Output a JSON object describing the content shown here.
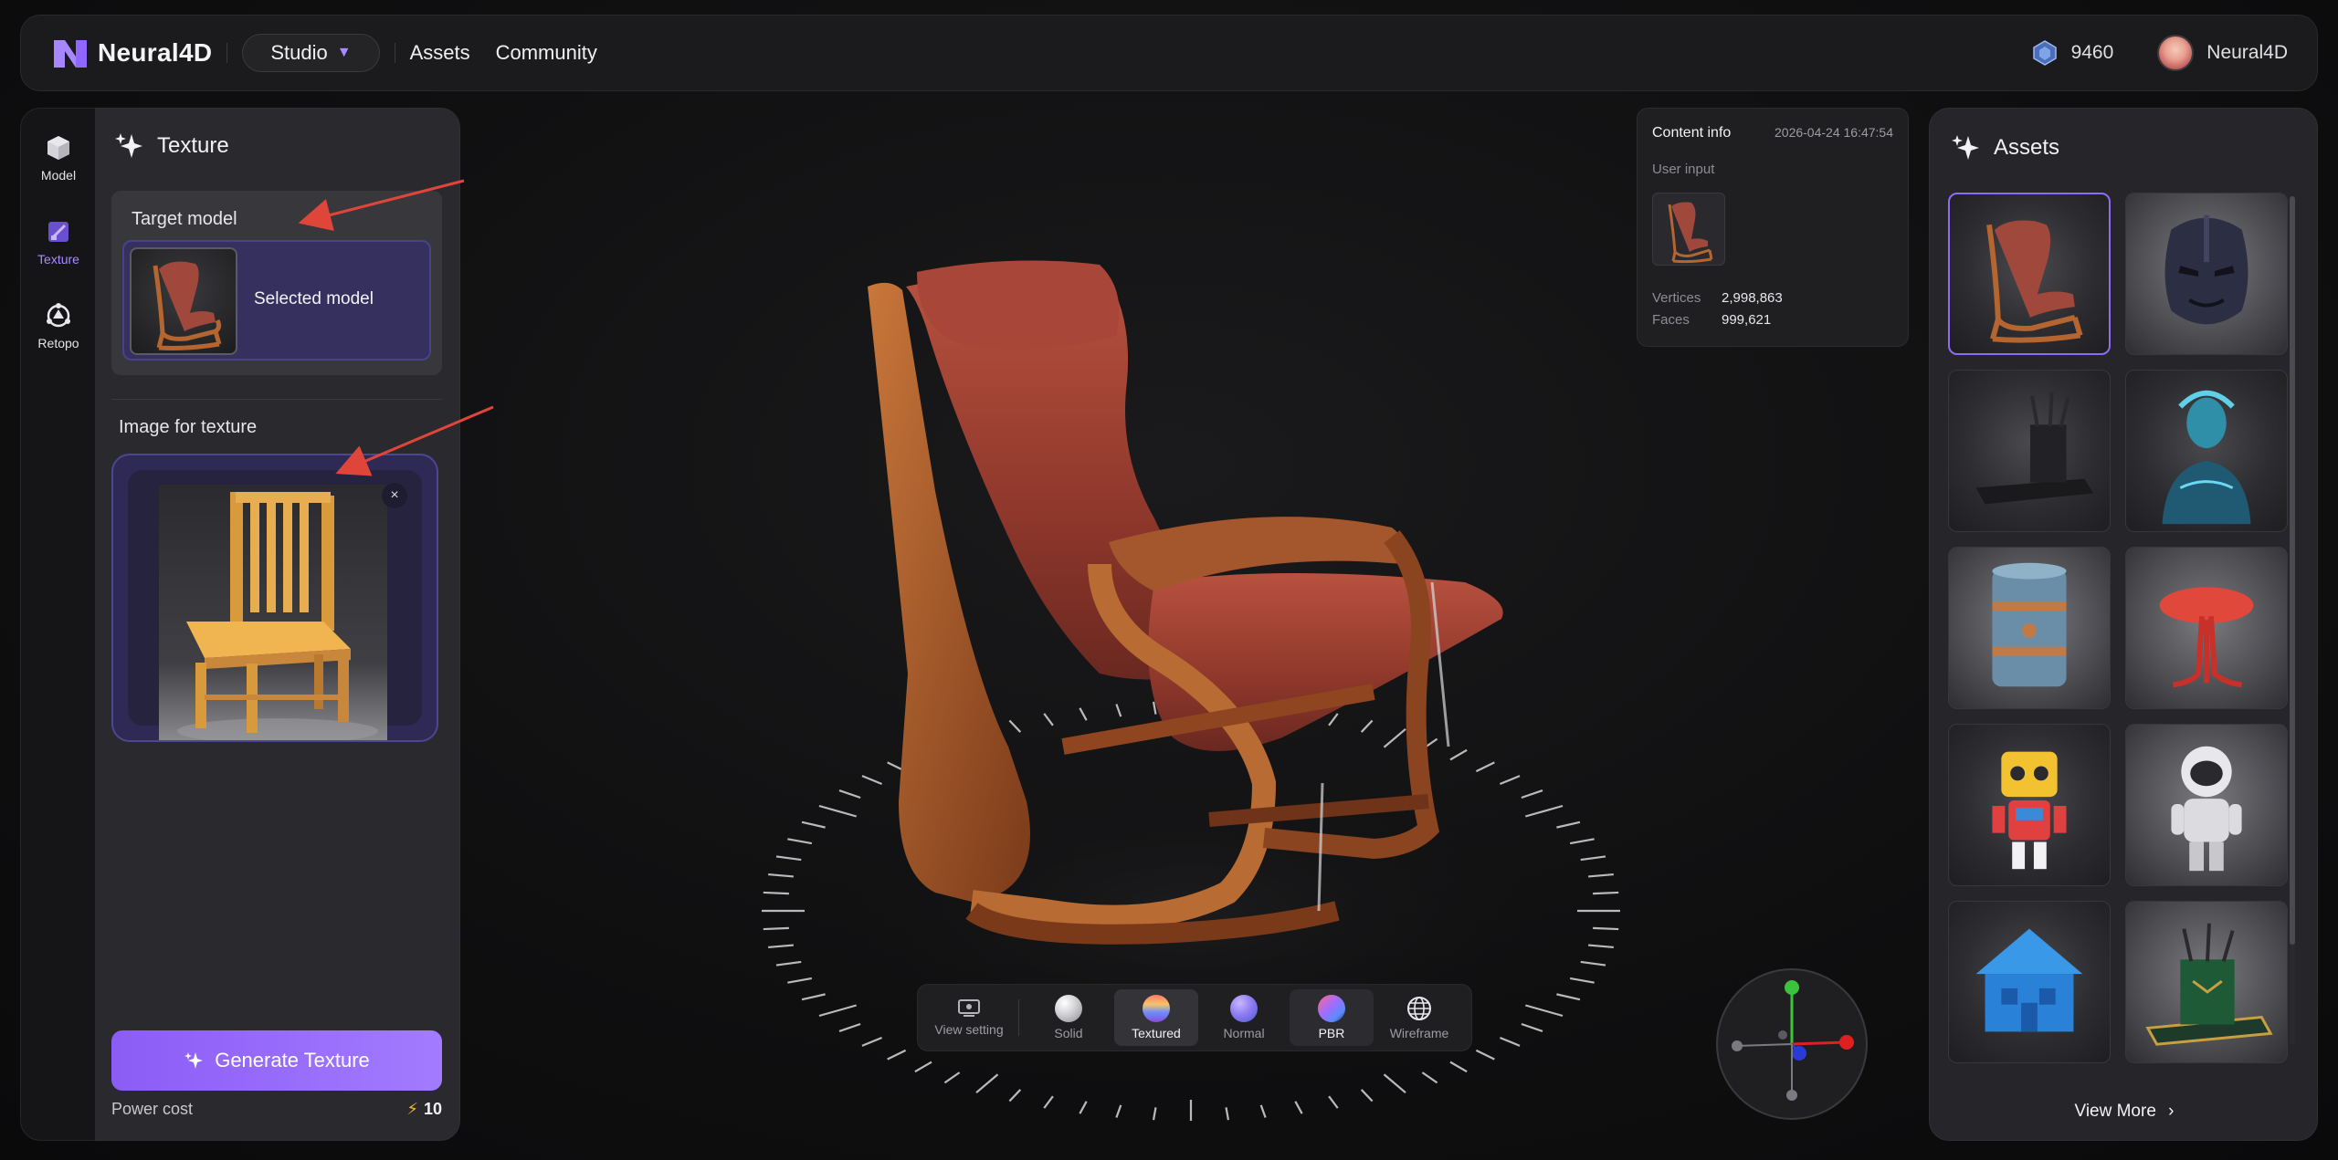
{
  "header": {
    "brand": "Neural4D",
    "studio_label": "Studio",
    "nav": [
      "Assets",
      "Community"
    ],
    "credits": "9460",
    "username": "Neural4D"
  },
  "rail": {
    "items": [
      {
        "label": "Model",
        "active": false
      },
      {
        "label": "Texture",
        "active": true
      },
      {
        "label": "Retopo",
        "active": false
      }
    ]
  },
  "panel": {
    "title": "Texture",
    "target_label": "Target model",
    "selected_text": "Selected model",
    "image_label": "Image for texture",
    "close_label": "×",
    "generate_label": "Generate Texture",
    "power_label": "Power cost",
    "power_value": "10"
  },
  "viewbar": {
    "items": [
      {
        "label": "View setting",
        "icon": "view-setting-icon"
      },
      {
        "label": "Solid",
        "icon": "solid-ball-icon"
      },
      {
        "label": "Textured",
        "icon": "textured-ball-icon",
        "active": true
      },
      {
        "label": "Normal",
        "icon": "normal-ball-icon"
      },
      {
        "label": "PBR",
        "icon": "pbr-ball-icon",
        "selected": true
      },
      {
        "label": "Wireframe",
        "icon": "wireframe-icon"
      }
    ]
  },
  "content_info": {
    "title": "Content info",
    "date": "2026-04-24 16:47:54",
    "user_input_label": "User input",
    "vertices_label": "Vertices",
    "vertices_value": "2,998,863",
    "faces_label": "Faces",
    "faces_value": "999,621"
  },
  "assets": {
    "title": "Assets",
    "view_more": "View More",
    "tiles": [
      "chair",
      "iron-helmet",
      "pen-holder-dark",
      "cyber-bust",
      "barrel",
      "red-mushroom",
      "robot",
      "astronaut",
      "blue-house",
      "pen-holder-green"
    ]
  },
  "colors": {
    "accent": "#8c5cf6",
    "panel_bg": "#2a2a2e",
    "selected_card": "#35305e",
    "arrow": "#e0453a"
  }
}
